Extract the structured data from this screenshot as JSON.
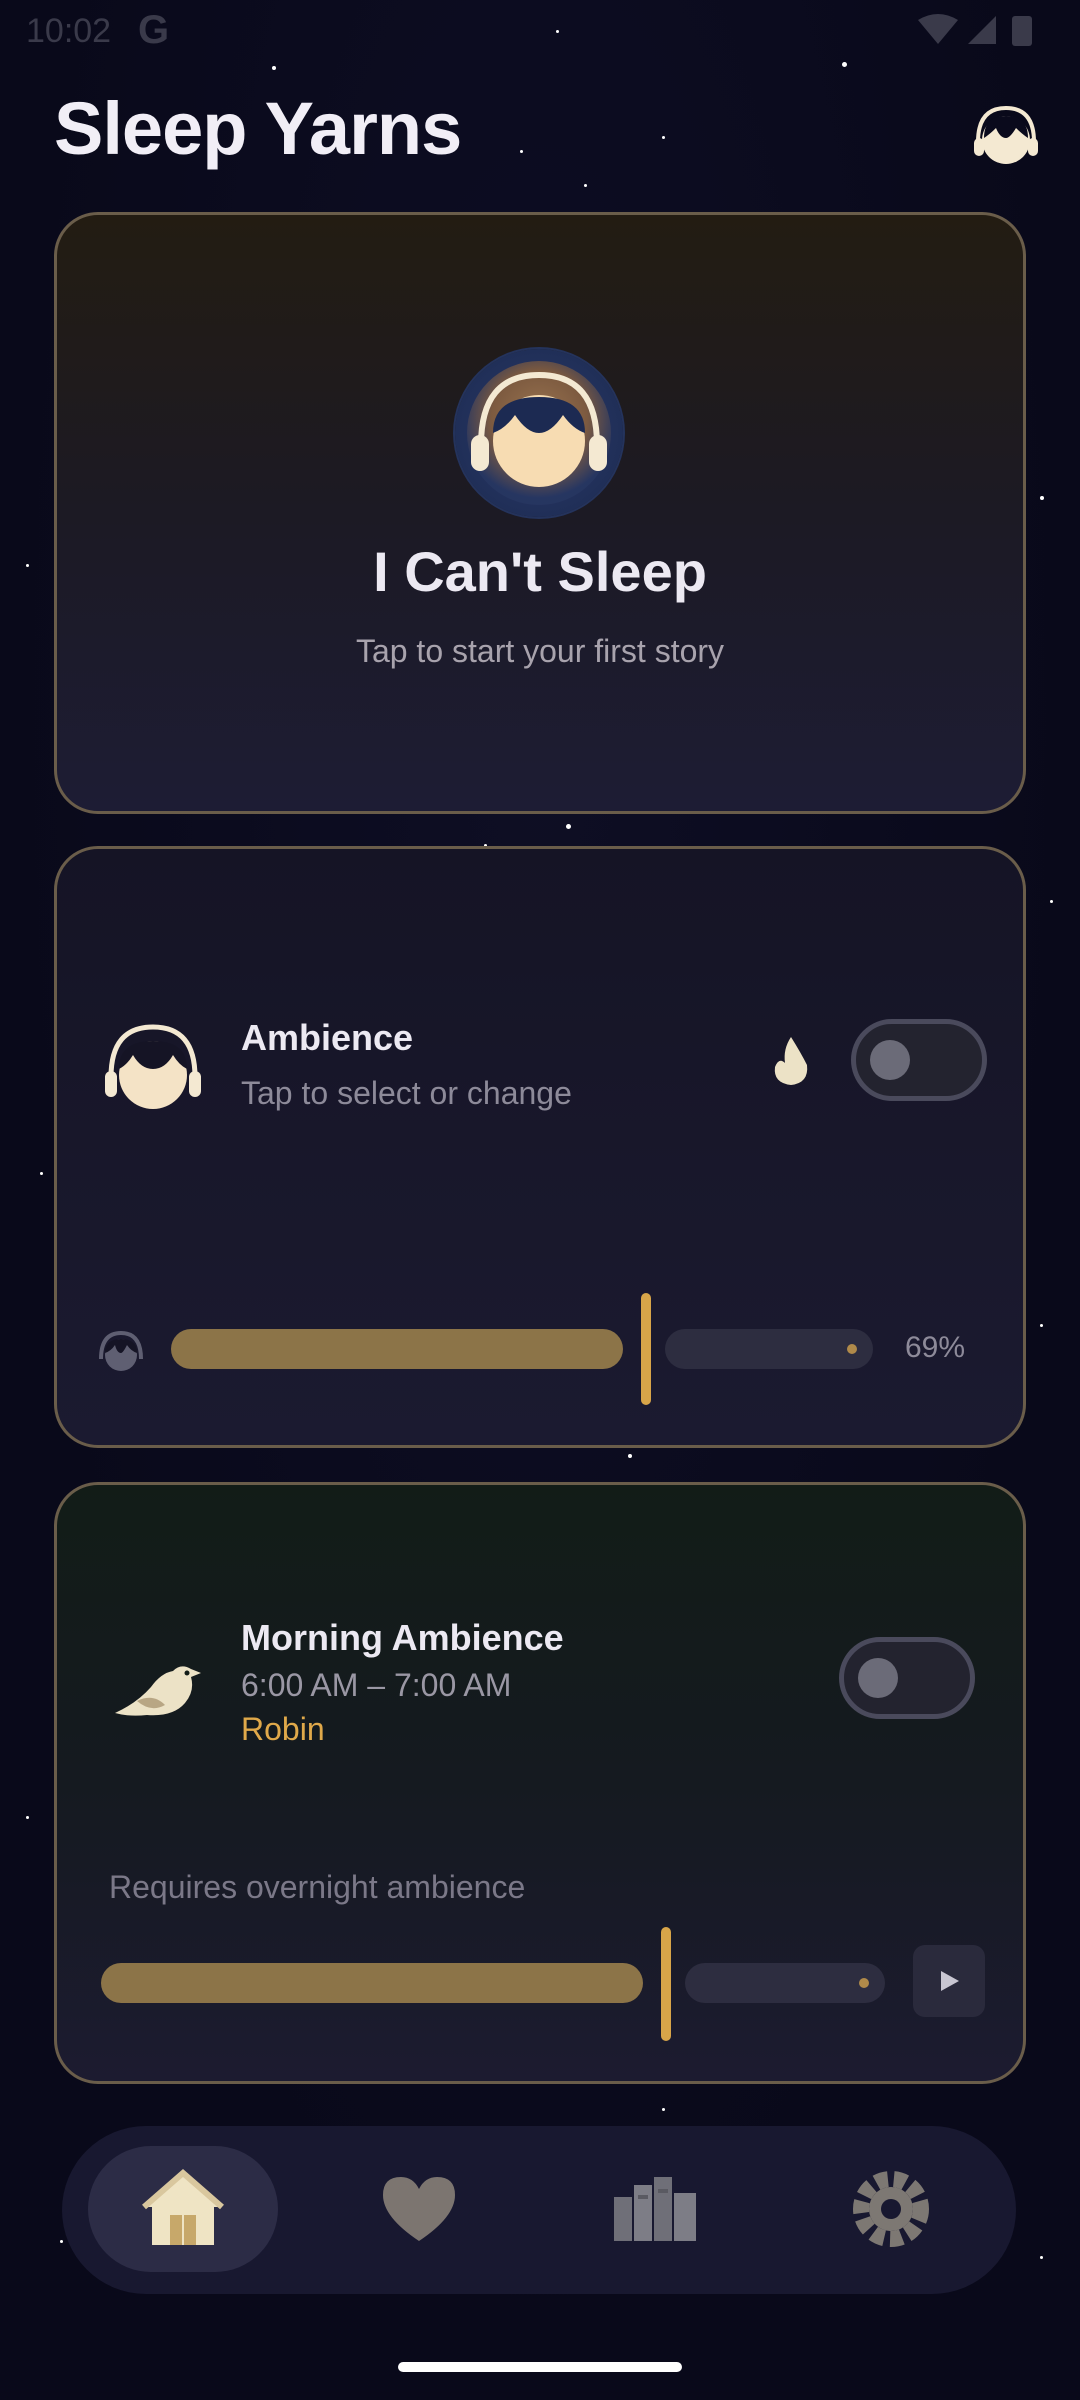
{
  "status_bar": {
    "time": "10:02",
    "g_logo": "G",
    "icons": [
      "wifi-icon",
      "cell-signal-icon",
      "battery-icon"
    ]
  },
  "header": {
    "title": "Sleep Yarns",
    "profile_icon": "sleeper-headphones-icon"
  },
  "hero_card": {
    "title": "I Can't Sleep",
    "subtitle": "Tap to start your first story",
    "icon": "sleeper-headphones-icon"
  },
  "ambience_card": {
    "title": "Ambience",
    "subtitle": "Tap to select or change",
    "flame_icon": "flame-icon",
    "toggle_on": false,
    "volume_percent": 69,
    "volume_label": "69%"
  },
  "morning_card": {
    "title": "Morning Ambience",
    "time_range": "6:00 AM – 7:00 AM",
    "sound": "Robin",
    "requirement": "Requires overnight ambience",
    "toggle_on": false,
    "volume_percent": 69
  },
  "bottom_nav": {
    "items": [
      {
        "name": "home",
        "icon": "home-icon",
        "active": true
      },
      {
        "name": "favorites",
        "icon": "heart-icon",
        "active": false
      },
      {
        "name": "library",
        "icon": "library-icon",
        "active": false
      },
      {
        "name": "settings",
        "icon": "gear-icon",
        "active": false
      }
    ]
  },
  "colors": {
    "background": "#0a0a1c",
    "accent_gold": "#d8a549",
    "card_border": "#6a5d4a",
    "accent_text": "#e0a94a"
  }
}
